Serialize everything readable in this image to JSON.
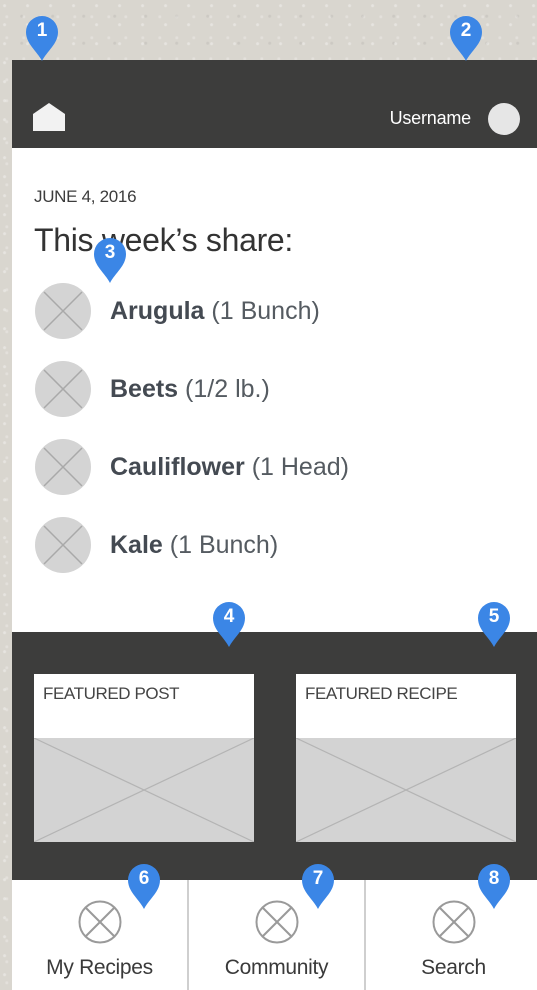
{
  "header": {
    "username": "Username"
  },
  "share": {
    "date": "JUNE 4, 2016",
    "title": "This week’s share:",
    "items": [
      {
        "name": "Arugula",
        "qty": "(1 Bunch)"
      },
      {
        "name": "Beets",
        "qty": "(1/2 lb.)"
      },
      {
        "name": "Cauliflower",
        "qty": "(1 Head)"
      },
      {
        "name": "Kale",
        "qty": "(1 Bunch)"
      }
    ]
  },
  "featured": {
    "post_label": "FEATURED POST",
    "recipe_label": "FEATURED RECIPE"
  },
  "tabs": {
    "my_recipes": "My Recipes",
    "community": "Community",
    "search": "Search"
  },
  "annotations": [
    "1",
    "2",
    "3",
    "4",
    "5",
    "6",
    "7",
    "8"
  ],
  "colors": {
    "bar": "#3d3d3c",
    "pin": "#3b86e6",
    "placeholder": "#d3d3d3"
  },
  "icons": [
    "home-icon",
    "avatar",
    "image-placeholder-icon",
    "annotation-pin"
  ]
}
